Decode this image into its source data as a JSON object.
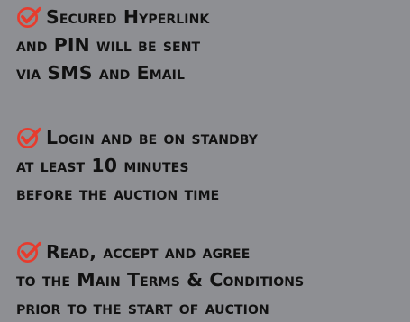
{
  "items": [
    {
      "icon": "check-circle-icon",
      "lines": [
        "Secured Hyperlink",
        "and PIN will be sent",
        "via SMS and Email"
      ]
    },
    {
      "icon": "check-circle-icon",
      "lines": [
        "Login and be on standby",
        "at least 10 minutes",
        "before the auction time"
      ]
    },
    {
      "icon": "check-circle-icon",
      "lines": [
        "Read, accept and agree",
        "to the Main Terms & Conditions",
        "prior to the start of auction"
      ]
    }
  ],
  "colors": {
    "background": "#8e8f93",
    "text": "#111111",
    "check": "#e73b2d"
  }
}
